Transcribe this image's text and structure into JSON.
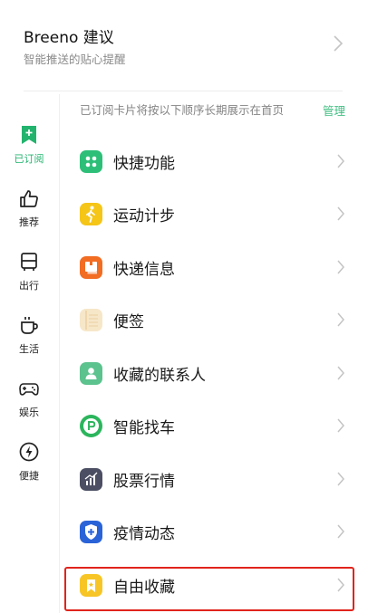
{
  "top_card": {
    "title": "Breeno 建议",
    "subtitle": "智能推送的贴心提醒"
  },
  "notice": {
    "text": "已订阅卡片将按以下顺序长期展示在首页",
    "action": "管理"
  },
  "sidebar": {
    "items": [
      {
        "label": "已订阅",
        "icon": "bookmark-plus-icon",
        "active": true
      },
      {
        "label": "推荐",
        "icon": "thumbs-up-icon",
        "active": false
      },
      {
        "label": "出行",
        "icon": "bus-icon",
        "active": false
      },
      {
        "label": "生活",
        "icon": "coffee-cup-icon",
        "active": false
      },
      {
        "label": "娱乐",
        "icon": "gamepad-icon",
        "active": false
      },
      {
        "label": "便捷",
        "icon": "lightning-icon",
        "active": false
      }
    ]
  },
  "cards": [
    {
      "label": "快捷功能",
      "icon": "quick-function-icon",
      "color": "#2dbf78"
    },
    {
      "label": "运动计步",
      "icon": "walking-icon",
      "color": "#f5c518"
    },
    {
      "label": "快递信息",
      "icon": "package-icon",
      "color": "#f26c22"
    },
    {
      "label": "便签",
      "icon": "note-icon",
      "color": "#f7e7c9"
    },
    {
      "label": "收藏的联系人",
      "icon": "contact-icon",
      "color": "#5cc28e"
    },
    {
      "label": "智能找车",
      "icon": "parking-icon",
      "color": "#2bb55c"
    },
    {
      "label": "股票行情",
      "icon": "stock-chart-icon",
      "color": "#4c4f63"
    },
    {
      "label": "疫情动态",
      "icon": "shield-plus-icon",
      "color": "#2a63d8"
    },
    {
      "label": "自由收藏",
      "icon": "bookmark-icon",
      "color": "#f7c626"
    }
  ],
  "colors": {
    "accent": "#22b46e",
    "highlight": "#e0241c"
  }
}
